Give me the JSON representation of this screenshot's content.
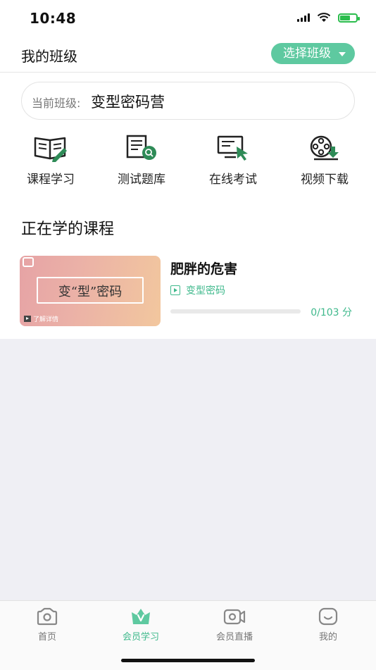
{
  "status_bar": {
    "time": "10:48"
  },
  "header": {
    "title": "我的班级",
    "select_class_label": "选择班级"
  },
  "current_class": {
    "label": "当前班级:",
    "value": "变型密码营"
  },
  "features": [
    {
      "label": "课程学习",
      "icon": "book-pen-icon"
    },
    {
      "label": "测试题库",
      "icon": "quiz-search-icon"
    },
    {
      "label": "在线考试",
      "icon": "monitor-cursor-icon"
    },
    {
      "label": "视频下载",
      "icon": "film-download-icon"
    }
  ],
  "section_title": "正在学的课程",
  "course": {
    "thumbnail_title": "变“型”密码",
    "thumbnail_more": "了解详情",
    "title": "肥胖的危害",
    "category": "变型密码",
    "progress_text": "0/103 分",
    "progress_value": 0
  },
  "tabbar": {
    "items": [
      {
        "label": "首页",
        "icon": "home-camera-icon",
        "active": false
      },
      {
        "label": "会员学习",
        "icon": "crown-v-icon",
        "active": true
      },
      {
        "label": "会员直播",
        "icon": "live-camera-icon",
        "active": false
      },
      {
        "label": "我的",
        "icon": "smile-face-icon",
        "active": false
      }
    ]
  },
  "colors": {
    "accent": "#5ec9a0",
    "accent_text": "#3fb98c",
    "background": "#efeff4"
  }
}
